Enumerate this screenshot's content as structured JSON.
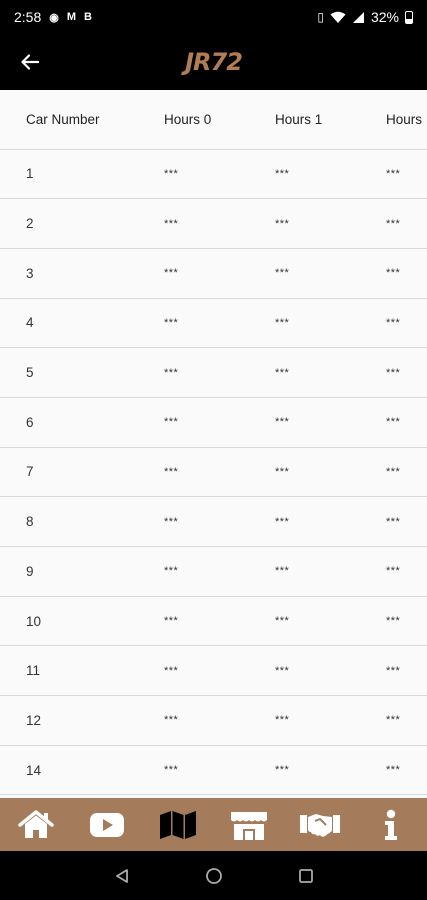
{
  "status_bar": {
    "time": "2:58",
    "notif_icons": [
      "◉",
      "M",
      "B"
    ],
    "battery": "32%"
  },
  "app_bar": {
    "logo_text": "JR72"
  },
  "table": {
    "headers": [
      "Car Number",
      "Hours 0",
      "Hours 1",
      "Hours"
    ],
    "rows": [
      [
        "1",
        "***",
        "***",
        "***"
      ],
      [
        "2",
        "***",
        "***",
        "***"
      ],
      [
        "3",
        "***",
        "***",
        "***"
      ],
      [
        "4",
        "***",
        "***",
        "***"
      ],
      [
        "5",
        "***",
        "***",
        "***"
      ],
      [
        "6",
        "***",
        "***",
        "***"
      ],
      [
        "7",
        "***",
        "***",
        "***"
      ],
      [
        "8",
        "***",
        "***",
        "***"
      ],
      [
        "9",
        "***",
        "***",
        "***"
      ],
      [
        "10",
        "***",
        "***",
        "***"
      ],
      [
        "11",
        "***",
        "***",
        "***"
      ],
      [
        "12",
        "***",
        "***",
        "***"
      ],
      [
        "14",
        "***",
        "***",
        "***"
      ]
    ]
  },
  "bottom_nav": {
    "items": [
      "home-icon",
      "youtube-icon",
      "map-icon",
      "store-icon",
      "handshake-icon",
      "info-icon"
    ]
  },
  "colors": {
    "accent": "#a47b5b",
    "logo": "#b07d55",
    "background": "#fafafa",
    "divider": "#d9d9d9"
  }
}
